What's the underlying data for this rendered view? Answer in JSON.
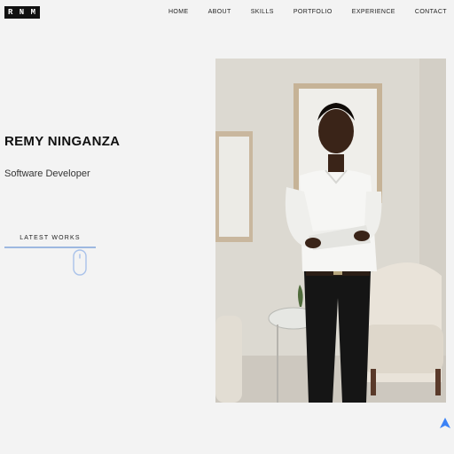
{
  "nav": {
    "logo_text": "R N M",
    "links": [
      "HOME",
      "ABOUT",
      "SKILLS",
      "PORTFOLIO",
      "EXPERIENCE",
      "CONTACT"
    ]
  },
  "hero": {
    "name": "REMY NINGANZA",
    "role": "Software Developer",
    "cta_label": "LATEST WORKS"
  },
  "icons": {
    "scroll_hint": "mouse-scroll-icon",
    "back_to_top": "arrow-up-icon"
  },
  "colors": {
    "background": "#f3f3f3",
    "accent": "#9db8e0",
    "back_to_top": "#3b82f6"
  }
}
